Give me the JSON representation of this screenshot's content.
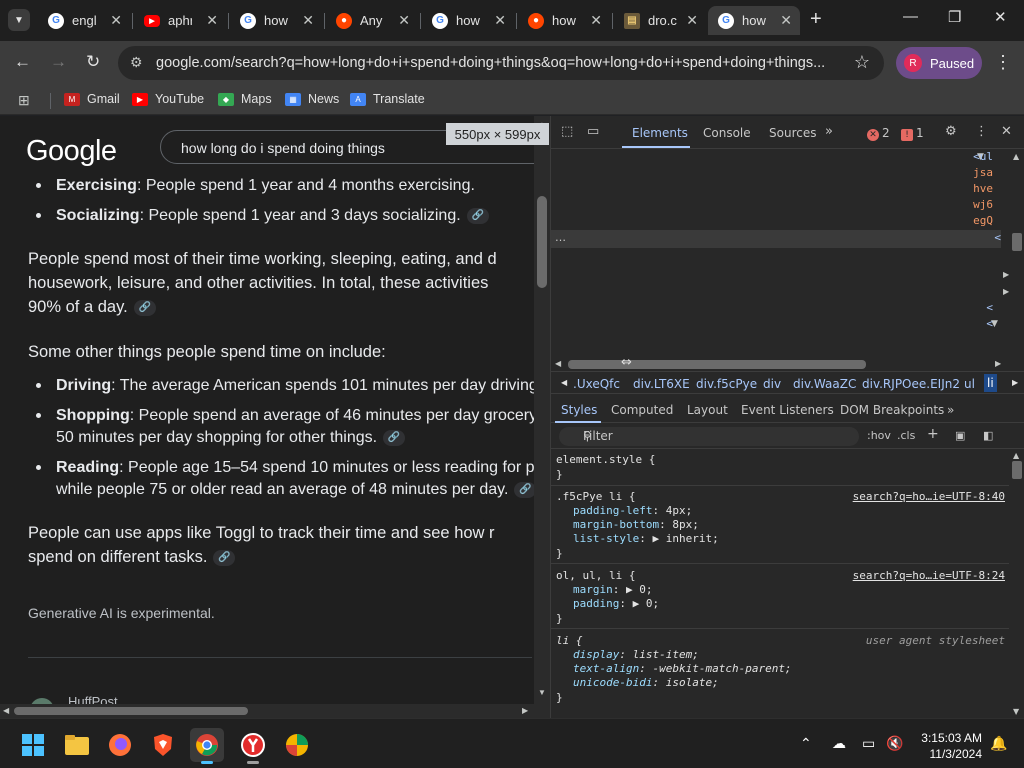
{
  "tabs": [
    {
      "label": "engli",
      "icon": "google-icon"
    },
    {
      "label": "aphr",
      "icon": "youtube-icon"
    },
    {
      "label": "how",
      "icon": "google-icon"
    },
    {
      "label": "Any",
      "icon": "reddit-icon"
    },
    {
      "label": "how",
      "icon": "google-icon"
    },
    {
      "label": "how",
      "icon": "reddit-icon"
    },
    {
      "label": "dro.c",
      "icon": "dropbox-icon"
    },
    {
      "label": "how",
      "icon": "google-icon",
      "active": true
    }
  ],
  "address_bar": {
    "url": "google.com/search?q=how+long+do+i+spend+doing+things&oq=how+long+do+i+spend+doing+things..."
  },
  "profile": {
    "initial": "R",
    "status": "Paused"
  },
  "bookmarks": [
    "Gmail",
    "YouTube",
    "Maps",
    "News",
    "Translate"
  ],
  "page": {
    "logo": "Google",
    "search_query": "how long do i spend doing things",
    "size_badge": "550px × 599px",
    "bullets_top": [
      {
        "term": "Exercising",
        "text": ": People spend 1 year and 4 months exercising."
      },
      {
        "term": "Socializing",
        "text": ": People spend 1 year and 3 days socializing."
      }
    ],
    "para1": [
      "People spend most of their time working, sleeping, eating, and d",
      "housework, leisure, and other activities. In total, these activities",
      "90% of a day."
    ],
    "para2": "Some other things people spend time on include:",
    "bullets_mid": [
      {
        "term": "Driving",
        "lines": [
          ": The average American spends 101 minutes per day driving"
        ]
      },
      {
        "term": "Shopping",
        "lines": [
          ": People spend an average of 46 minutes per day grocery",
          "50 minutes per day shopping for other things."
        ]
      },
      {
        "term": "Reading",
        "lines": [
          ": People age 15–54 spend 10 minutes or less reading for p",
          "while people 75 or older read an average of 48 minutes per day."
        ]
      }
    ],
    "para3": [
      "People can use apps like Toggl to track their time and see how r",
      "spend on different tasks."
    ],
    "disclaimer": "Generative AI is experimental.",
    "source_cut": "HuffPost"
  },
  "devtools": {
    "tabs": [
      "Elements",
      "Console",
      "Sources"
    ],
    "errors": "2",
    "warnings": "1",
    "dom_fragments": [
      "<ul",
      "jsa",
      "hve",
      "wj6",
      "egQ",
      "<",
      "<",
      "<"
    ],
    "ellipsis": "…",
    "breadcrumbs": [
      ".UxeQfc",
      "div.LT6XE",
      "div.f5cPye",
      "div",
      "div.WaaZC",
      "div.RJPOee.EIJn2",
      "ul",
      "li"
    ],
    "panel_tabs": [
      "Styles",
      "Computed",
      "Layout",
      "Event Listeners",
      "DOM Breakpoints"
    ],
    "filter_placeholder": "Filter",
    "filter_tools": [
      ":hov",
      ".cls",
      "+"
    ],
    "rules": [
      {
        "selector": "element.style {",
        "close": "}",
        "props": []
      },
      {
        "selector": ".f5cPye li {",
        "source": "search?q=ho…ie=UTF-8:40",
        "close": "}",
        "props": [
          [
            "padding-left",
            "4px;"
          ],
          [
            "margin-bottom",
            "8px;"
          ],
          [
            "list-style",
            "▶ inherit;"
          ]
        ]
      },
      {
        "selector": "ol, ul, li {",
        "source": "search?q=ho…ie=UTF-8:24",
        "close": "}",
        "props": [
          [
            "margin",
            "▶ 0;"
          ],
          [
            "padding",
            "▶ 0;"
          ]
        ]
      },
      {
        "selector": "li {",
        "source": "user agent stylesheet",
        "close": "}",
        "props": [
          [
            "display",
            "list-item;"
          ],
          [
            "text-align",
            "-webkit-match-parent;"
          ],
          [
            "unicode-bidi",
            "isolate;"
          ]
        ]
      }
    ]
  },
  "taskbar": {
    "time": "3:15:03 AM",
    "date": "11/3/2024"
  },
  "colors": {
    "accent": "#a8c7fa",
    "paused_bg": "#6d4c8a",
    "error": "#e46962"
  }
}
